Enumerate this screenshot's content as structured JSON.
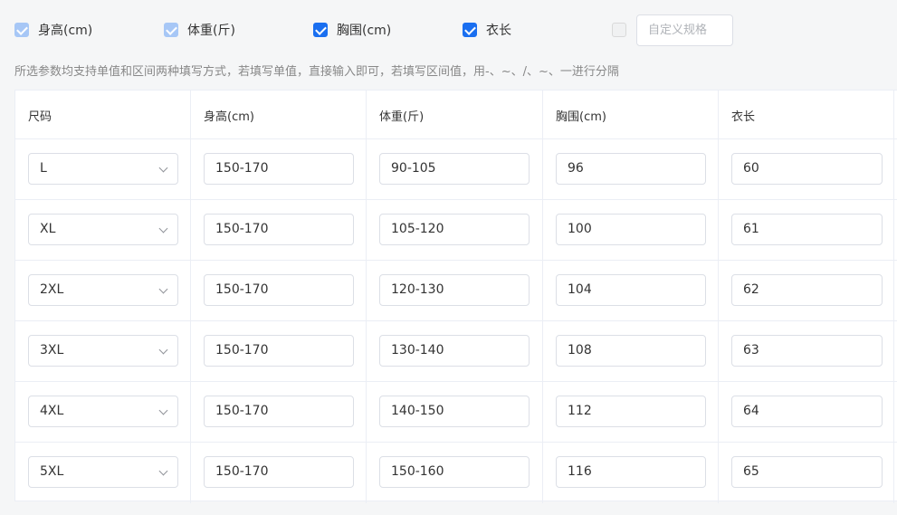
{
  "checkboxes": [
    {
      "label": "身高(cm)",
      "state": "checked-disabled"
    },
    {
      "label": "体重(斤)",
      "state": "checked-disabled"
    },
    {
      "label": "胸围(cm)",
      "state": "checked"
    },
    {
      "label": "衣长",
      "state": "checked"
    },
    {
      "label": "",
      "state": "disabled"
    }
  ],
  "custom_spec": {
    "placeholder": "自定义规格",
    "value": ""
  },
  "hint": "所选参数均支持单值和区间两种填写方式，若填写单值，直接输入即可，若填写区间值，用-、~、/、~、一进行分隔",
  "table": {
    "headers": [
      "尺码",
      "身高(cm)",
      "体重(斤)",
      "胸围(cm)",
      "衣长"
    ],
    "rows": [
      {
        "size": "L",
        "height": "150-170",
        "weight": "90-105",
        "chest": "96",
        "length": "60"
      },
      {
        "size": "XL",
        "height": "150-170",
        "weight": "105-120",
        "chest": "100",
        "length": "61"
      },
      {
        "size": "2XL",
        "height": "150-170",
        "weight": "120-130",
        "chest": "104",
        "length": "62"
      },
      {
        "size": "3XL",
        "height": "150-170",
        "weight": "130-140",
        "chest": "108",
        "length": "63"
      },
      {
        "size": "4XL",
        "height": "150-170",
        "weight": "140-150",
        "chest": "112",
        "length": "64"
      },
      {
        "size": "5XL",
        "height": "150-170",
        "weight": "150-160",
        "chest": "116",
        "length": "65"
      }
    ]
  },
  "colors": {
    "accent": "#1a6ff0",
    "accent_disabled": "#a7c7f6",
    "border": "#ebeef5"
  }
}
